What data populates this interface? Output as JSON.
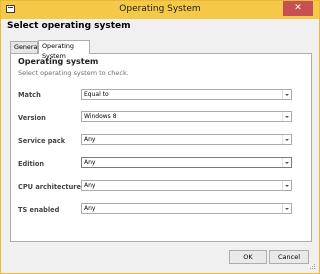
{
  "window": {
    "title": "Operating System",
    "close_glyph": "✕"
  },
  "dialog": {
    "heading": "Select operating system"
  },
  "tabs": [
    {
      "label": "General"
    },
    {
      "label": "Operating System"
    }
  ],
  "panel": {
    "title": "Operating system",
    "subtitle": "Select operating system to check."
  },
  "fields": [
    {
      "label": "Match",
      "value": "Equal to"
    },
    {
      "label": "Version",
      "value": "Windows 8"
    },
    {
      "label": "Service pack",
      "value": "Any"
    },
    {
      "label": "Edition",
      "value": "Any"
    },
    {
      "label": "CPU architecture",
      "value": "Any"
    },
    {
      "label": "TS enabled",
      "value": "Any"
    }
  ],
  "buttons": {
    "ok": "OK",
    "cancel": "Cancel"
  }
}
